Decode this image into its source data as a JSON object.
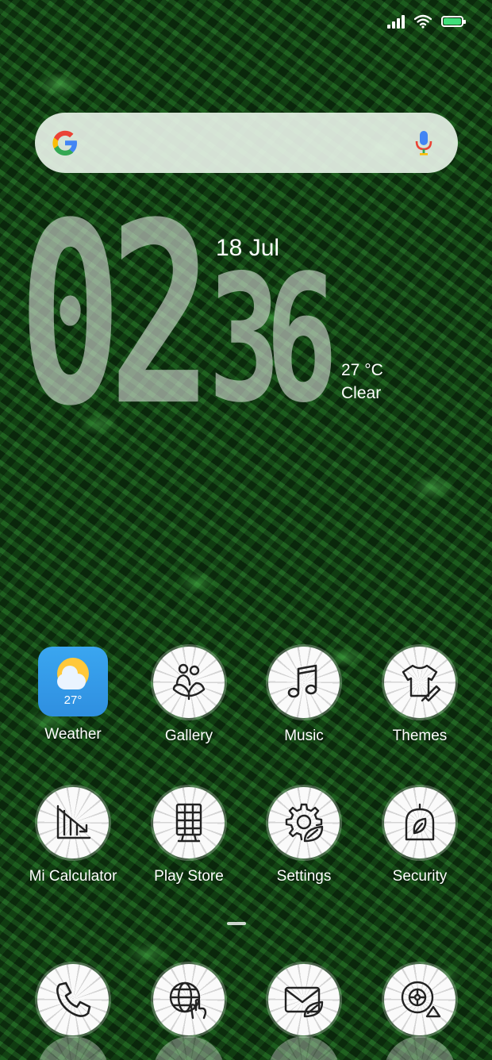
{
  "status_bar": {
    "battery_color": "#3ee07a"
  },
  "search": {
    "google_icon": "google-logo-icon",
    "mic_icon": "microphone-icon"
  },
  "clock": {
    "hour_1": "0",
    "hour_2": "2",
    "minute_1": "3",
    "minute_2": "6",
    "date": "18 Jul",
    "temperature": "27 °C",
    "condition": "Clear"
  },
  "apps": [
    {
      "label": "Weather",
      "icon": "weather-icon",
      "icon_text": "27°"
    },
    {
      "label": "Gallery",
      "icon": "gallery-icon"
    },
    {
      "label": "Music",
      "icon": "music-note-icon"
    },
    {
      "label": "Themes",
      "icon": "tshirt-brush-icon"
    },
    {
      "label": "Mi Calculator",
      "icon": "calculator-icon"
    },
    {
      "label": "Play Store",
      "icon": "store-grid-icon"
    },
    {
      "label": "Settings",
      "icon": "gear-leaf-icon"
    },
    {
      "label": "Security",
      "icon": "shield-leaf-icon"
    }
  ],
  "dock": [
    {
      "icon": "phone-icon"
    },
    {
      "icon": "globe-hand-icon"
    },
    {
      "icon": "mail-leaf-icon"
    },
    {
      "icon": "camera-lens-icon"
    }
  ]
}
